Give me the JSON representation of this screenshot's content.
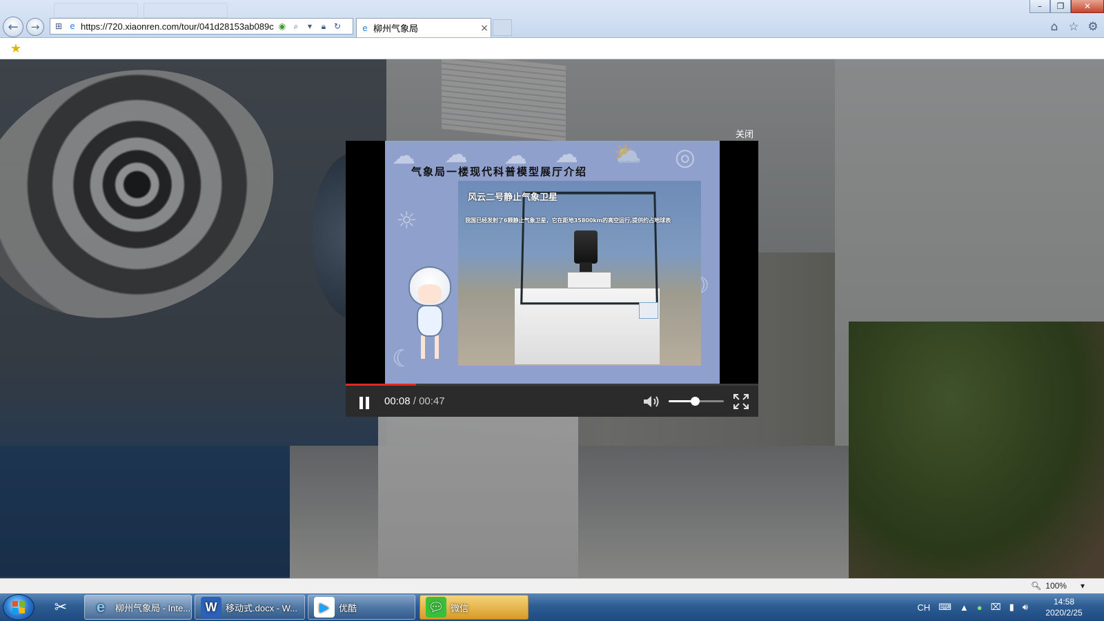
{
  "browser": {
    "address_url": "https://720.xiaonren.com/tour/041d28153ab089c",
    "tab_title": "柳州气象局",
    "tab_close": "×",
    "zoom_level": "100%"
  },
  "modal": {
    "close_label": "关闭"
  },
  "video": {
    "title": "气象局一楼现代科普模型展厅介绍",
    "subtitle": "风云二号静止气象卫星",
    "caption": "我国已经发射了6颗静止气象卫星，它在距地35800km的高空运行,提供约占地球表",
    "current_time": "00:08",
    "time_separator": "/",
    "duration": "00:47",
    "progress_fraction": 0.17,
    "volume_fraction": 0.48
  },
  "taskbar": {
    "items": [
      {
        "label": "柳州气象局 - Inte...",
        "icon": "ie-icon",
        "active": true
      },
      {
        "label": "移动式.docx - W...",
        "icon": "word-icon",
        "active": false
      },
      {
        "label": "优酷",
        "icon": "youku-icon",
        "active": false
      },
      {
        "label": "微信",
        "icon": "wechat-icon",
        "active": false,
        "flashing": true
      }
    ],
    "tray_lang": "CH",
    "clock_time": "14:58",
    "clock_date": "2020/2/25"
  },
  "colors": {
    "progress_red": "#e02a1f",
    "frame_blue": "#8fa0cc",
    "taskbar_blue": "#2d5d93"
  }
}
